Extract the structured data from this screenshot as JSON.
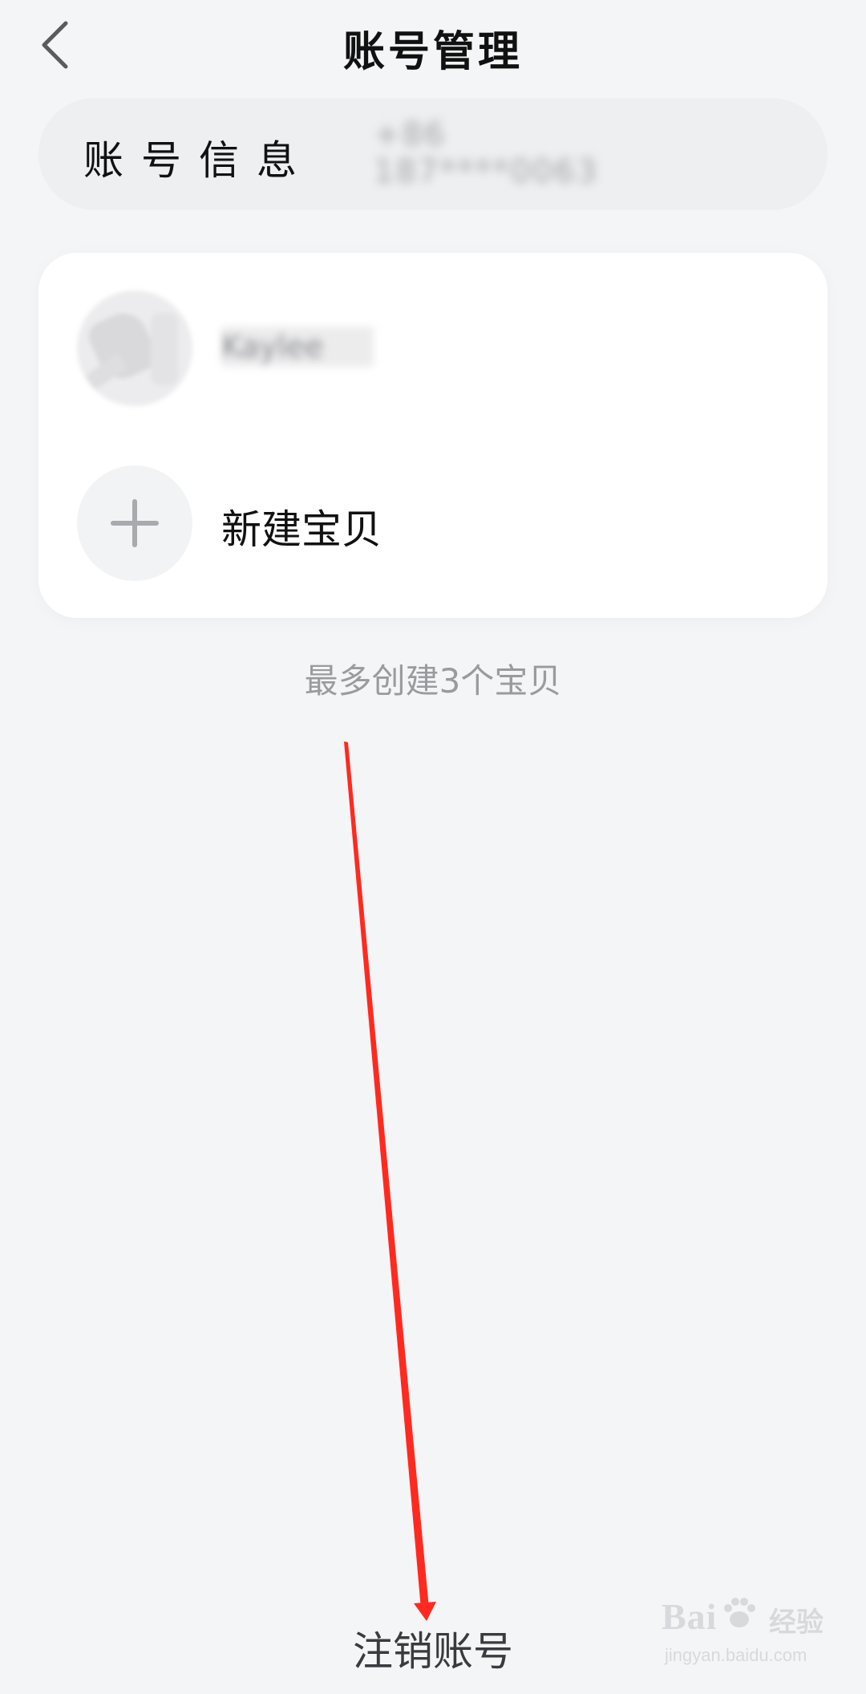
{
  "header": {
    "title": "账号管理",
    "back_icon": "chevron-left-icon"
  },
  "account_info": {
    "label": "账号信息",
    "value": "+86 187****0063"
  },
  "children": [
    {
      "name": "Kaylee",
      "avatar_icon": "pig-avatar"
    }
  ],
  "new_child": {
    "label": "新建宝贝",
    "icon": "plus-icon"
  },
  "limit_note": "最多创建3个宝贝",
  "cancel_account": "注销账号",
  "annotation": {
    "arrow_color": "#ff2a1f"
  },
  "watermark": {
    "brand": "Bai  ",
    "brand_sub": "经验",
    "url": "jingyan.baidu.com"
  },
  "colors": {
    "background": "#f4f5f7",
    "card": "#ffffff",
    "info_pill": "#eeeff1",
    "muted_text": "#9a9b9f"
  }
}
